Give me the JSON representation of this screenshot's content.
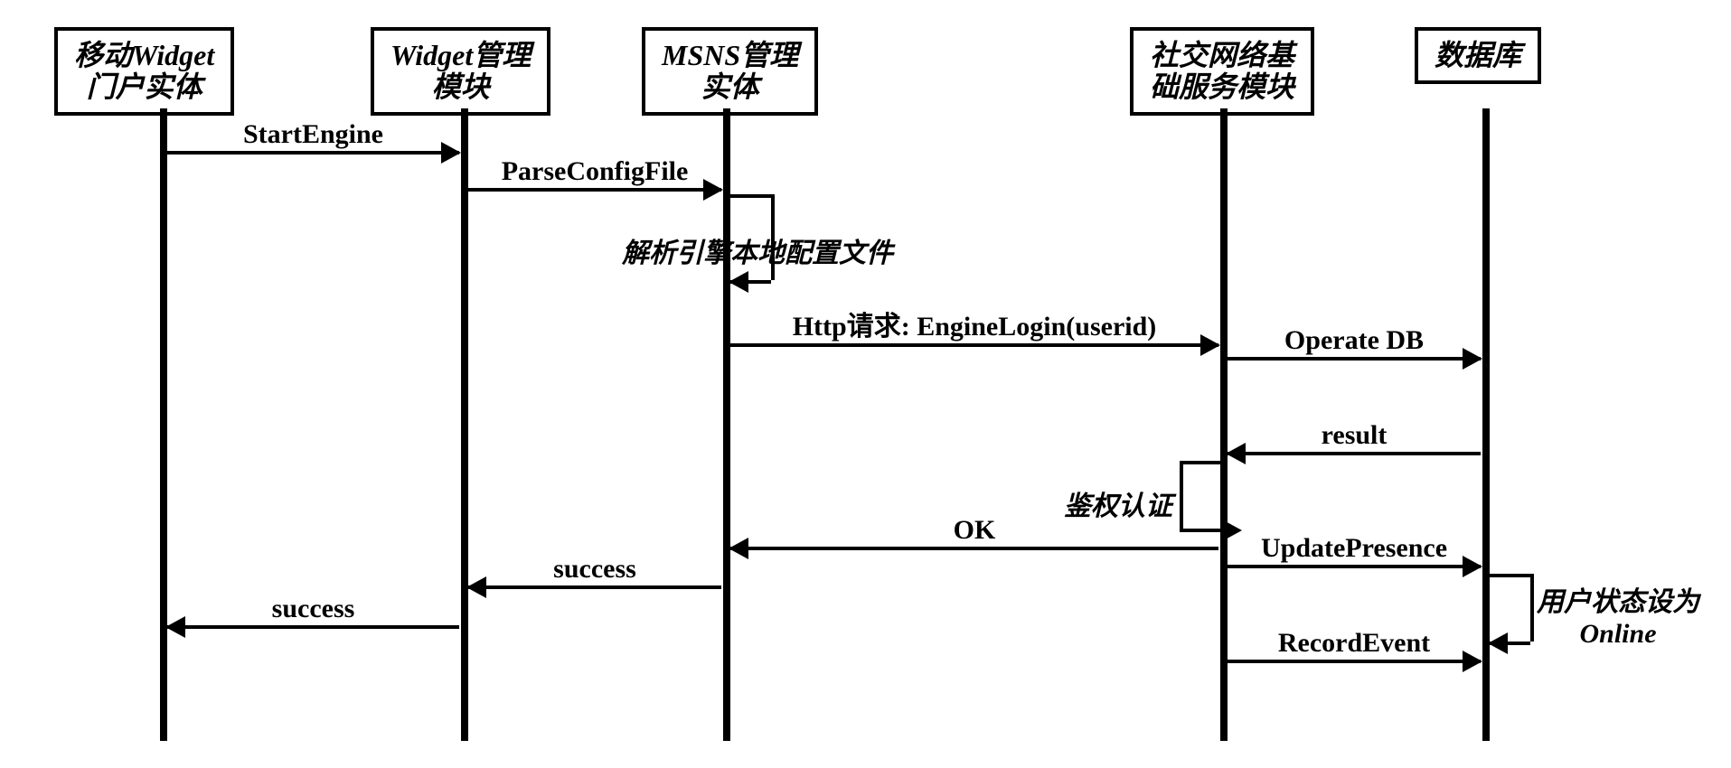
{
  "participants": {
    "p1": "移动Widget\n门户实体",
    "p2": "Widget管理\n模块",
    "p3": "MSNS管理\n实体",
    "p4": "社交网络基\n础服务模块",
    "p5": "数据库"
  },
  "messages": {
    "m1": "StartEngine",
    "m2": "ParseConfigFile",
    "m3_self": "解析引擎本地配置文件",
    "m4": "Http请求:\nEngineLogin(userid)",
    "m5": "Operate DB",
    "m6": "result",
    "m7_self": "鉴权认证",
    "m8": "OK",
    "m9": "UpdatePresence",
    "m10": "success",
    "m11": "success",
    "m12": "RecordEvent",
    "note_right": "用户状态设为\nOnline",
    "db_self": ""
  }
}
